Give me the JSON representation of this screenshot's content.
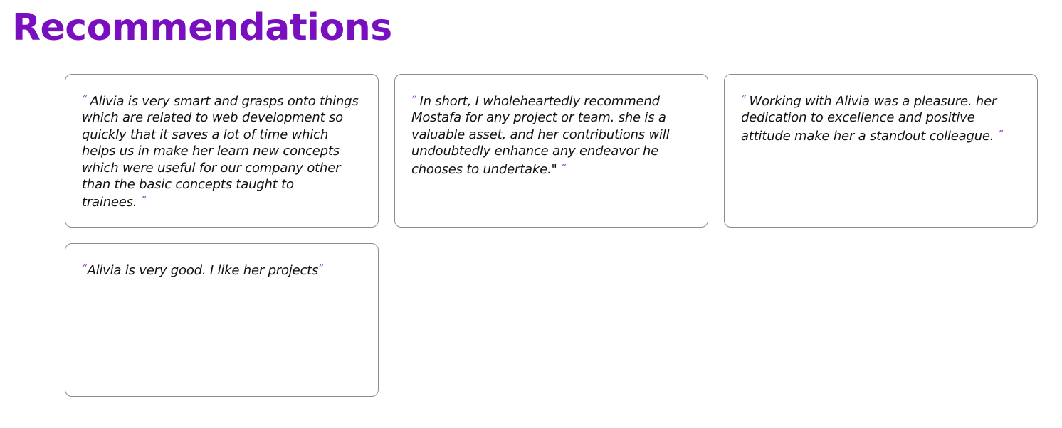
{
  "page": {
    "title": "Recommendations",
    "accent_color": "#7a0fbf",
    "quote_mark_color": "#9a3fcf"
  },
  "recommendations": [
    {
      "open_mark": "“",
      "text": "Alivia is very smart and grasps onto things which are related to web development so quickly that it saves a lot of time which helps us in make her learn new concepts which were useful for our company other than the basic concepts taught to trainees.",
      "close_mark": "”"
    },
    {
      "open_mark": "“",
      "text": "In short, I wholeheartedly recommend Mostafa for any project or team. she is a valuable asset, and her contributions will undoubtedly enhance any endeavor he chooses to undertake.\"",
      "close_mark": "”"
    },
    {
      "open_mark": "“",
      "text": "Working with Alivia was a pleasure. her dedication to excellence and positive attitude make her a standout colleague.",
      "close_mark": "”"
    },
    {
      "open_mark": "“",
      "text": "Alivia is very good. I like her projects",
      "close_mark": "”"
    }
  ]
}
